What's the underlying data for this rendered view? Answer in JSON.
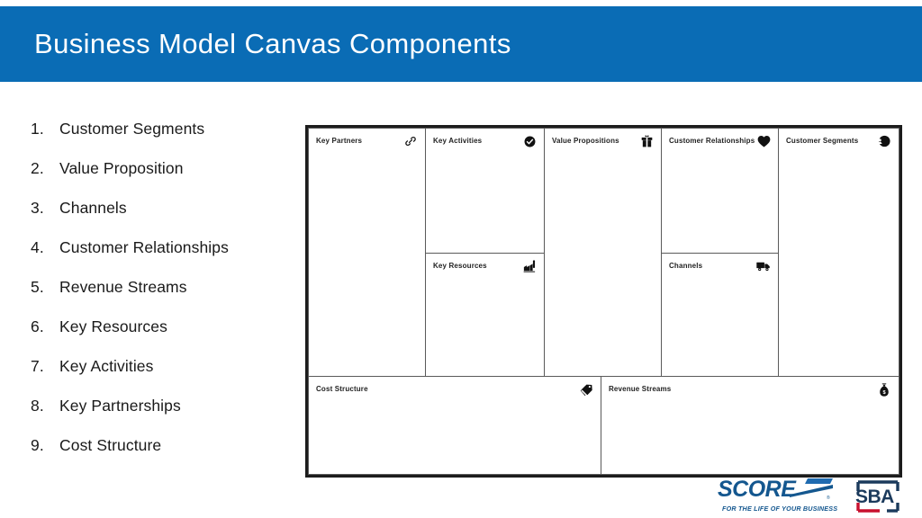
{
  "slide": {
    "title": "Business Model Canvas Components",
    "title_bar_color": "#0a6cb5",
    "background_color": "#ffffff"
  },
  "component_list": [
    {
      "number": "1.",
      "label": "Customer Segments"
    },
    {
      "number": "2.",
      "label": "Value Proposition"
    },
    {
      "number": "3.",
      "label": "Channels"
    },
    {
      "number": "4.",
      "label": "Customer Relationships"
    },
    {
      "number": "5.",
      "label": "Revenue Streams"
    },
    {
      "number": "6.",
      "label": "Key Resources"
    },
    {
      "number": "7.",
      "label": "Key Activities"
    },
    {
      "number": "8.",
      "label": "Key Partnerships"
    },
    {
      "number": "9.",
      "label": "Cost Structure"
    }
  ],
  "canvas": {
    "cells": [
      {
        "id": "key-partners",
        "title": "Key Partners",
        "icon": "chain-link-icon"
      },
      {
        "id": "key-activities",
        "title": "Key Activities",
        "icon": "check-circle-icon"
      },
      {
        "id": "key-resources",
        "title": "Key Resources",
        "icon": "factory-icon"
      },
      {
        "id": "value-propositions",
        "title": "Value Propositions",
        "icon": "gift-icon"
      },
      {
        "id": "customer-relationships",
        "title": "Customer Relationships",
        "icon": "heart-icon"
      },
      {
        "id": "channels",
        "title": "Channels",
        "icon": "delivery-truck-icon"
      },
      {
        "id": "customer-segments",
        "title": "Customer Segments",
        "icon": "person-circle-icon"
      },
      {
        "id": "cost-structure",
        "title": "Cost Structure",
        "icon": "price-tags-icon"
      },
      {
        "id": "revenue-streams",
        "title": "Revenue Streams",
        "icon": "money-bag-icon"
      }
    ],
    "border_color": "#1c1c1c"
  },
  "logos": {
    "score": {
      "wordmark": "SCORE",
      "registered": "®",
      "tagline": "FOR THE LIFE OF YOUR BUSINESS",
      "color": "#14578f"
    },
    "sba": {
      "wordmark": "SBA",
      "navy": "#1b3a5c",
      "red": "#c8102e"
    }
  }
}
